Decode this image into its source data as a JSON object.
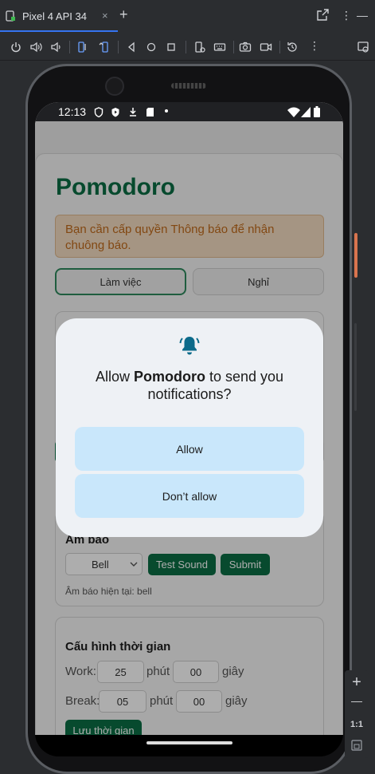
{
  "emulator": {
    "tab_label": "Pixel 4 API 34",
    "tab_close": "×",
    "tab_add": "+",
    "more": "⋮",
    "minimize": "—",
    "zoom_in": "+",
    "zoom_out": "—",
    "zoom_ratio": "1:1"
  },
  "status_bar": {
    "time": "12:13"
  },
  "app": {
    "title": "Pomodoro",
    "warning": "Bạn cần cấp quyền Thông báo để nhận chuông báo.",
    "mode_work": "Làm việc",
    "mode_break": "Nghỉ",
    "sound_section": {
      "heading": "Âm báo",
      "select_value": "Bell",
      "test_button": "Test Sound",
      "submit_button": "Submit",
      "current": "Âm báo hiện tại: bell"
    },
    "time_section": {
      "heading": "Cấu hình thời gian",
      "work_label": "Work:",
      "work_minutes": "25",
      "work_seconds": "00",
      "break_label": "Break:",
      "break_minutes": "05",
      "break_seconds": "00",
      "minute_unit": "phút",
      "second_unit": "giây",
      "save_button": "Lưu thời gian"
    }
  },
  "dialog": {
    "title_prefix": "Allow ",
    "title_app": "Pomodoro",
    "title_suffix": " to send you notifications?",
    "allow": "Allow",
    "deny": "Don’t allow"
  },
  "colors": {
    "brand_green": "#0b6e44",
    "dialog_button": "#c9e7fb",
    "bell_icon": "#0b6a8a"
  }
}
